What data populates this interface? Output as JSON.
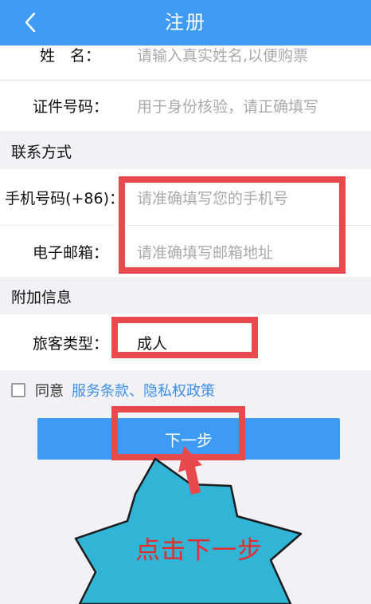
{
  "header": {
    "title": "注册"
  },
  "fields": {
    "name": {
      "label": "姓　名：",
      "placeholder": "请输入真实姓名,以便购票"
    },
    "id_number": {
      "label": "证件号码：",
      "placeholder": "用于身份核验，请正确填写"
    },
    "phone": {
      "label": "手机号码(+86)：",
      "placeholder": "请准确填写您的手机号"
    },
    "email": {
      "label": "电子邮箱：",
      "placeholder": "请准确填写邮箱地址"
    },
    "passenger_type": {
      "label": "旅客类型：",
      "value": "成人"
    }
  },
  "sections": {
    "contact": "联系方式",
    "extra": "附加信息"
  },
  "agreement": {
    "prefix": "同意",
    "terms": "服务条款",
    "separator": "、",
    "privacy": "隐私权政策"
  },
  "buttons": {
    "next": "下一步"
  },
  "annotation": {
    "callout": "点击下一步"
  },
  "colors": {
    "header": "#3d9bf3",
    "annotation_red": "#e8494d",
    "callout_fill": "#31b4d6",
    "link": "#3d8ee6"
  }
}
